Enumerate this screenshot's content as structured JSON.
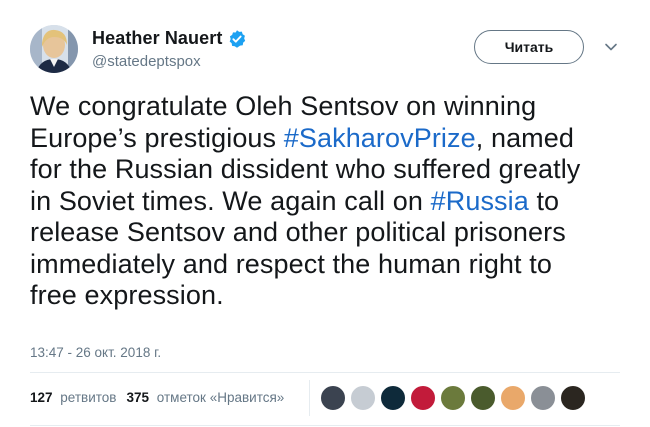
{
  "author": {
    "name": "Heather Nauert",
    "handle": "@statedeptspox",
    "verified": true,
    "verified_color": "#1da1f2"
  },
  "follow_button": {
    "label": "Читать"
  },
  "tweet": {
    "parts": [
      {
        "text": "We congratulate Oleh Sentsov on winning\nEurope’s prestigious ",
        "type": "text"
      },
      {
        "text": "#SakharovPrize",
        "type": "hashtag"
      },
      {
        "text": ", named\nfor the Russian dissident who suffered greatly\nin Soviet times. We again call on ",
        "type": "text"
      },
      {
        "text": "#Russia",
        "type": "hashtag"
      },
      {
        "text": " to\nrelease Sentsov and other political prisoners\nimmediately and respect the human right to\nfree expression.",
        "type": "text"
      }
    ],
    "hashtag_color": "#1b6ac9"
  },
  "timestamp": "13:47 - 26 окт. 2018 г.",
  "stats": {
    "retweets_count": "127",
    "retweets_label": "ретвитов",
    "likes_count": "375",
    "likes_label": "отметок «Нравится»"
  },
  "likers": [
    {
      "name": "liker-1",
      "color": "#3b4350"
    },
    {
      "name": "liker-2",
      "color": "#c6ccd3"
    },
    {
      "name": "liker-3",
      "color": "#0e2a3a"
    },
    {
      "name": "liker-4",
      "color": "#c21b3a"
    },
    {
      "name": "liker-5",
      "color": "#6b7a3c"
    },
    {
      "name": "liker-6",
      "color": "#4a5b2d"
    },
    {
      "name": "liker-7",
      "color": "#e9a86a"
    },
    {
      "name": "liker-8",
      "color": "#8a8f96"
    },
    {
      "name": "liker-9",
      "color": "#2b2620"
    }
  ]
}
